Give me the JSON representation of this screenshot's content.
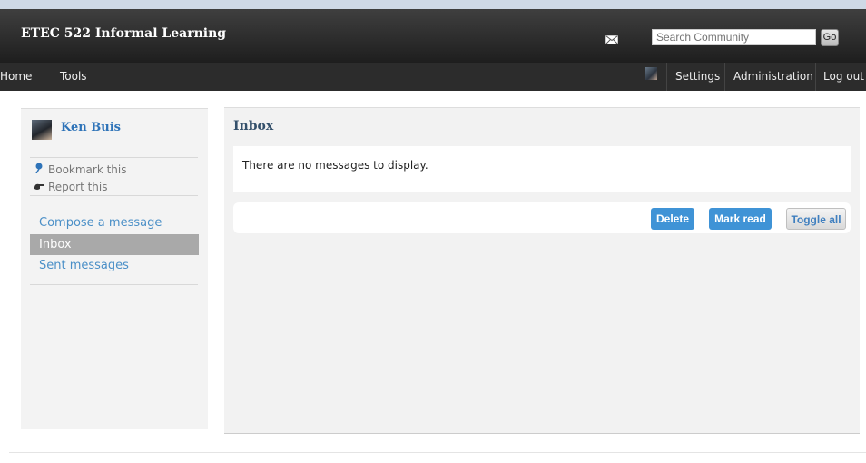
{
  "site": {
    "title": "ETEC 522 Informal Learning"
  },
  "search": {
    "placeholder": "Search Community",
    "go_label": "Go"
  },
  "nav": {
    "left": [
      {
        "label": "Home"
      },
      {
        "label": "Tools"
      }
    ],
    "right": [
      {
        "label": "Settings"
      },
      {
        "label": "Administration"
      },
      {
        "label": "Log out"
      }
    ]
  },
  "sidebar": {
    "owner_name": "Ken Buis",
    "actions": [
      {
        "label": "Bookmark this",
        "icon": "pushpin-icon"
      },
      {
        "label": "Report this",
        "icon": "report-hand-icon"
      }
    ],
    "links": [
      {
        "label": "Compose a message",
        "active": false
      },
      {
        "label": "Inbox",
        "active": true
      },
      {
        "label": "Sent messages",
        "active": false
      }
    ]
  },
  "main": {
    "title": "Inbox",
    "empty_message": "There are no messages to display.",
    "buttons": {
      "delete": "Delete",
      "mark_read": "Mark read",
      "toggle_all": "Toggle all"
    }
  },
  "colors": {
    "accent": "#3f93d6",
    "link": "#4a8fc7",
    "topbar": "#2c2c2c",
    "active_item": "#a9a9a9"
  }
}
